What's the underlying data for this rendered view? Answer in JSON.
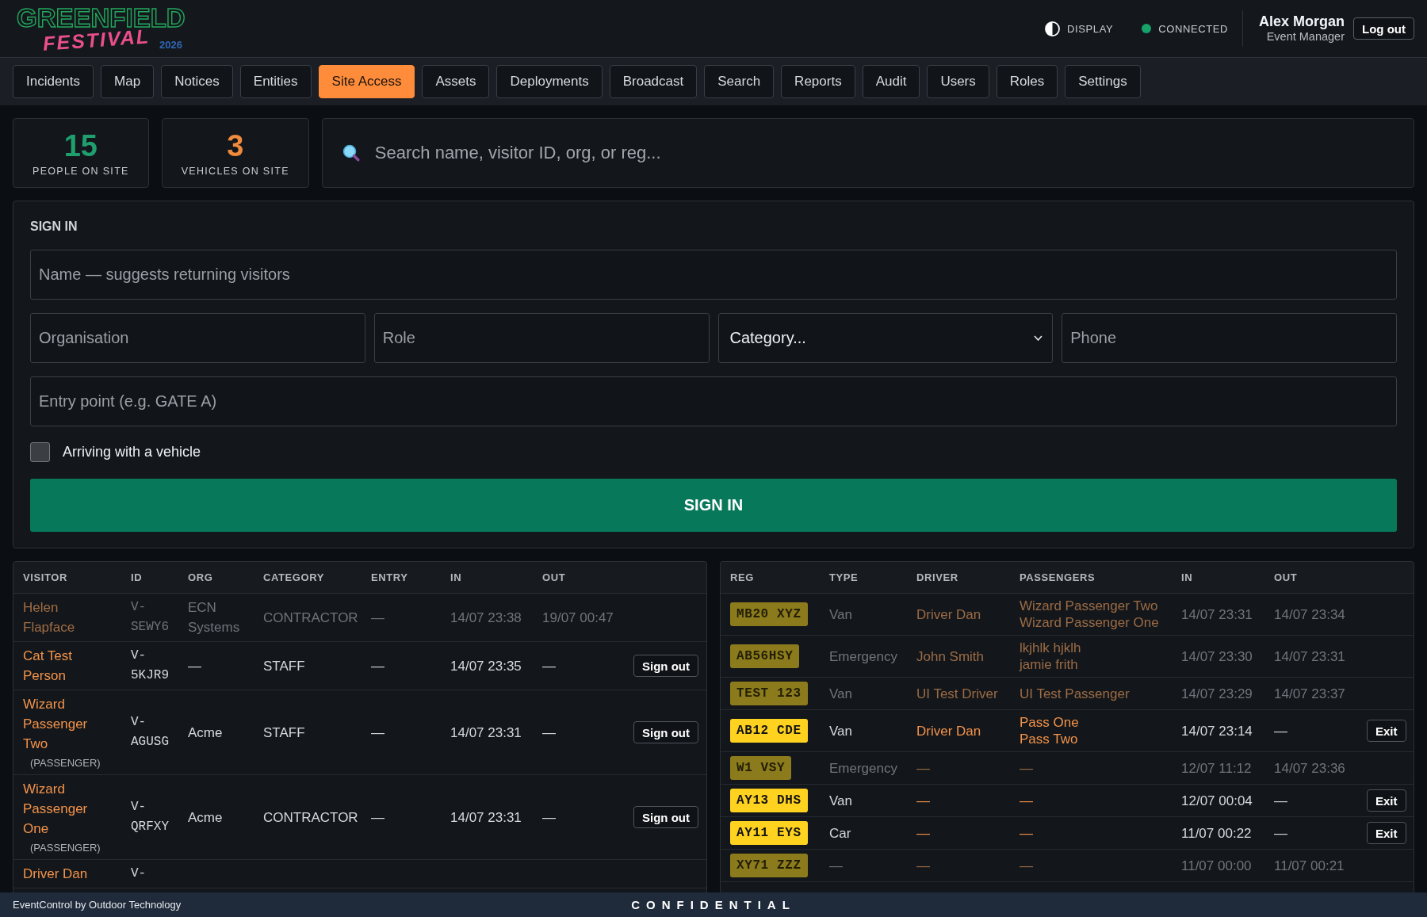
{
  "logo": {
    "wordmark": "GREENFIELD",
    "script": "FESTIVAL",
    "year": "2026"
  },
  "header": {
    "display_button": {
      "label": "DISPLAY"
    },
    "connection": {
      "label": "CONNECTED",
      "connected": true
    },
    "user": {
      "name": "Alex Morgan",
      "role": "Event Manager"
    },
    "logout_button": {
      "label": "Log out"
    }
  },
  "nav_tabs": [
    {
      "label": "Incidents",
      "selected": false
    },
    {
      "label": "Map",
      "selected": false
    },
    {
      "label": "Notices",
      "selected": false
    },
    {
      "label": "Entities",
      "selected": false
    },
    {
      "label": "Site Access",
      "selected": true
    },
    {
      "label": "Assets",
      "selected": false
    },
    {
      "label": "Deployments",
      "selected": false
    },
    {
      "label": "Broadcast",
      "selected": false
    },
    {
      "label": "Search",
      "selected": false
    },
    {
      "label": "Reports",
      "selected": false
    },
    {
      "label": "Audit",
      "selected": false
    },
    {
      "label": "Users",
      "selected": false
    },
    {
      "label": "Roles",
      "selected": false
    },
    {
      "label": "Settings",
      "selected": false
    }
  ],
  "stats": [
    {
      "value": "15",
      "label": "PEOPLE ON SITE",
      "color": "#1f9e6e"
    },
    {
      "value": "3",
      "label": "VEHICLES ON SITE",
      "color": "#f08a3c"
    }
  ],
  "search": {
    "placeholder": "Search name, visitor ID, org, or reg..."
  },
  "sign_in": {
    "title": "SIGN IN",
    "field_rows": [
      [
        {
          "kind": "input",
          "placeholder": "Name — suggests returning visitors"
        }
      ],
      [
        {
          "kind": "input",
          "placeholder": "Organisation"
        },
        {
          "kind": "input",
          "placeholder": "Role"
        },
        {
          "kind": "select",
          "value": "Category..."
        },
        {
          "kind": "input",
          "placeholder": "Phone"
        }
      ],
      [
        {
          "kind": "input",
          "placeholder": "Entry point (e.g. GATE A)"
        }
      ]
    ],
    "vehicle_checkbox": {
      "label": "Arriving with a vehicle",
      "checked": false
    },
    "submit_button": {
      "label": "SIGN IN"
    }
  },
  "visitors_table": {
    "columns": [
      "VISITOR",
      "ID",
      "ORG",
      "CATEGORY",
      "ENTRY",
      "IN",
      "OUT"
    ],
    "rows": [
      {
        "visitor": "Helen Flapface",
        "id": "V-SEWY6",
        "org": "ECN Systems",
        "category": "CONTRACTOR",
        "entry": "—",
        "in": "14/07 23:38",
        "out": "19/07 00:47",
        "on_site": false
      },
      {
        "visitor": "Cat Test Person",
        "id": "V-5KJR9",
        "org": "—",
        "category": "STAFF",
        "entry": "—",
        "in": "14/07 23:35",
        "out": "—",
        "on_site": true,
        "action": "Sign out"
      },
      {
        "visitor": "Wizard Passenger Two",
        "note": "(PASSENGER)",
        "id": "V-AGUSG",
        "org": "Acme",
        "category": "STAFF",
        "entry": "—",
        "in": "14/07 23:31",
        "out": "—",
        "on_site": true,
        "action": "Sign out"
      },
      {
        "visitor": "Wizard Passenger One",
        "note": "(PASSENGER)",
        "id": "V-QRFXY",
        "org": "Acme",
        "category": "CONTRACTOR",
        "entry": "—",
        "in": "14/07 23:31",
        "out": "—",
        "on_site": true,
        "action": "Sign out"
      },
      {
        "visitor": "Driver Dan",
        "id": "V-",
        "on_site": true
      }
    ]
  },
  "vehicles_table": {
    "columns": [
      "REG",
      "TYPE",
      "DRIVER",
      "PASSENGERS",
      "IN",
      "OUT"
    ],
    "rows": [
      {
        "reg": "MB20 XYZ",
        "type": "Van",
        "driver": "Driver Dan",
        "passengers": [
          "Wizard Passenger Two",
          "Wizard Passenger One"
        ],
        "in": "14/07 23:31",
        "out": "14/07 23:34",
        "on_site": false
      },
      {
        "reg": "AB56HSY",
        "type": "Emergency",
        "driver": "John Smith",
        "passengers": [
          "lkjhlk hjklh",
          "jamie frith"
        ],
        "in": "14/07 23:30",
        "out": "14/07 23:31",
        "on_site": false
      },
      {
        "reg": "TEST 123",
        "type": "Van",
        "driver": "UI Test Driver",
        "passengers": [
          "UI Test Passenger"
        ],
        "in": "14/07 23:29",
        "out": "14/07 23:37",
        "on_site": false
      },
      {
        "reg": "AB12 CDE",
        "type": "Van",
        "driver": "Driver Dan",
        "passengers": [
          "Pass One",
          "Pass Two"
        ],
        "in": "14/07 23:14",
        "out": "—",
        "on_site": true,
        "action": "Exit"
      },
      {
        "reg": "W1 VSY",
        "type": "Emergency",
        "driver": "—",
        "passengers": [
          "—"
        ],
        "in": "12/07 11:12",
        "out": "14/07 23:36",
        "on_site": false
      },
      {
        "reg": "AY13 DHS",
        "type": "Van",
        "driver": "—",
        "passengers": [
          "—"
        ],
        "in": "12/07 00:04",
        "out": "—",
        "on_site": true,
        "action": "Exit"
      },
      {
        "reg": "AY11 EYS",
        "type": "Car",
        "driver": "—",
        "passengers": [
          "—"
        ],
        "in": "11/07 00:22",
        "out": "—",
        "on_site": true,
        "action": "Exit"
      },
      {
        "reg": "XY71 ZZZ",
        "type": "—",
        "driver": "—",
        "passengers": [
          "—"
        ],
        "in": "11/07 00:00",
        "out": "11/07 00:21",
        "on_site": false
      }
    ]
  },
  "footer": {
    "credit": "EventControl by Outdoor Technology",
    "classification": "CONFIDENTIAL"
  }
}
